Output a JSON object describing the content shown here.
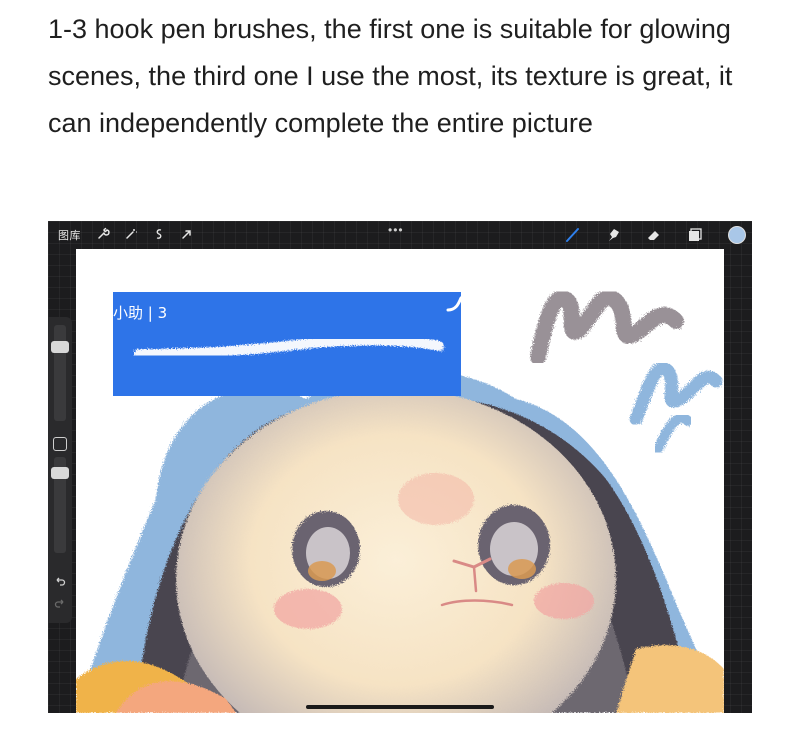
{
  "caption": "1-3 hook pen brushes, the first one is suitable for glowing scenes, the third one I use the most, its texture is great, it can independently complete the entire picture",
  "app": {
    "gallery_label": "图库",
    "more_label": "•••",
    "color_swatch": "#a9c7e8",
    "brush_preview": {
      "label": "小助 | 3",
      "background": "#2e74e8"
    }
  },
  "icons": {
    "top_left": [
      "wrench-icon",
      "magic-wand-icon",
      "selection-icon",
      "transform-arrow-icon"
    ],
    "top_right": [
      "brush-icon",
      "smudge-icon",
      "eraser-icon",
      "layers-icon"
    ],
    "sidebar": [
      "undo-icon",
      "redo-icon"
    ]
  }
}
